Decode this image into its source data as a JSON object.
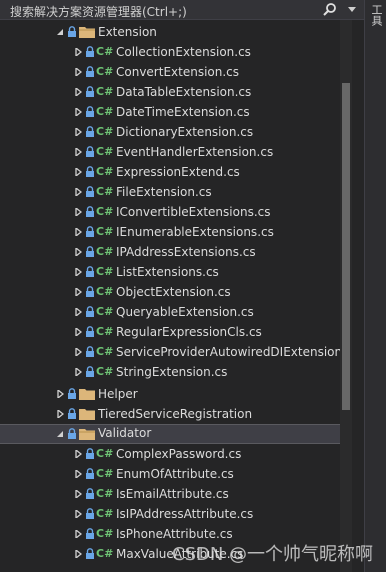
{
  "search": {
    "placeholder_text": "搜索解决方案资源管理器(Ctrl+;)",
    "icon": "search-icon"
  },
  "side_panel": {
    "label": "工具"
  },
  "tree": {
    "extension_folder": "Extension",
    "extension_files": [
      "CollectionExtension.cs",
      "ConvertExtension.cs",
      "DataTableExtension.cs",
      "DateTimeExtension.cs",
      "DictionaryExtension.cs",
      "EventHandlerExtension.cs",
      "ExpressionExtend.cs",
      "FileExtension.cs",
      "IConvertibleExtensions.cs",
      "IEnumerableExtensions.cs",
      "IPAddressExtensions.cs",
      "ListExtensions.cs",
      "ObjectExtension.cs",
      "QueryableExtension.cs",
      "RegularExpressionCls.cs",
      "ServiceProviderAutowiredDIExtension.",
      "StringExtension.cs"
    ],
    "helper_folder": "Helper",
    "tiered_folder": "TieredServiceRegistration",
    "validator_folder": "Validator",
    "validator_files": [
      "ComplexPassword.cs",
      "EnumOfAttribute.cs",
      "IsEmailAttribute.cs",
      "IsIPAddressAttribute.cs",
      "IsPhoneAttribute.cs",
      "MaxValueAttribute.cs"
    ],
    "cs_badge": "C#"
  },
  "watermark": "CSDN @一个帅气昵称啊",
  "colors": {
    "background": "#252526",
    "csharp_badge": "#6ec274",
    "folder": "#dcb67a",
    "selected_row": "#3f3f46"
  }
}
